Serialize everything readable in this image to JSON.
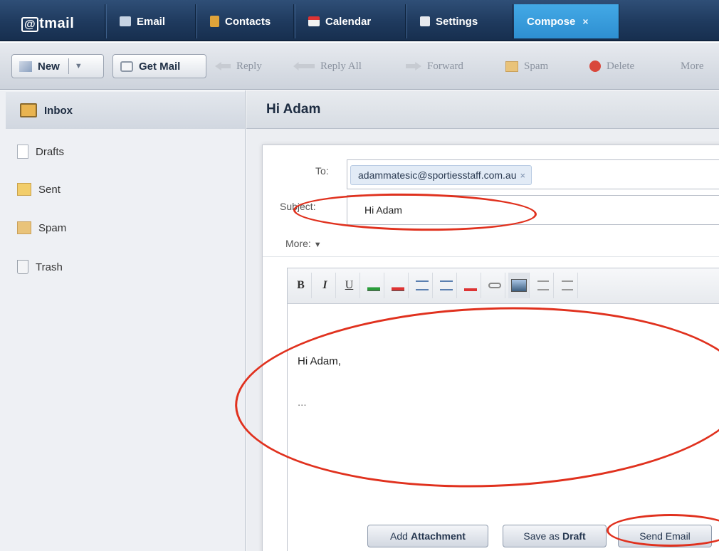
{
  "nav": {
    "logo_at": "@",
    "logo_rest": "tmail",
    "tabs": [
      {
        "label": "Email",
        "icon": "envelope-icon"
      },
      {
        "label": "Contacts",
        "icon": "address-book-icon"
      },
      {
        "label": "Calendar",
        "icon": "calendar-icon"
      },
      {
        "label": "Settings",
        "icon": "settings-icon"
      }
    ],
    "active_tab": {
      "label": "Compose",
      "close": "×"
    }
  },
  "toolbar": {
    "new": "New",
    "new_arrow": "▼",
    "get_mail": "Get Mail",
    "reply": "Reply",
    "reply_all": "Reply All",
    "forward": "Forward",
    "spam": "Spam",
    "delete": "Delete",
    "more": "More"
  },
  "sidebar": {
    "inbox": "Inbox",
    "folders": [
      "Drafts",
      "Sent",
      "Spam",
      "Trash"
    ]
  },
  "message": {
    "title": "Hi Adam"
  },
  "compose": {
    "to_label": "To:",
    "to_recipient": "adammatesic@sportiesstaff.com.au",
    "chip_remove": "×",
    "subject_label": "Subject:",
    "subject_value": "Hi Adam",
    "more_label": "More:",
    "more_arrow": "▼",
    "body_line1": "Hi Adam,",
    "body_line2": "...",
    "add_attachment_pre": "Add",
    "add_attachment_bold": "Attachment",
    "save_draft_pre": "Save as",
    "save_draft_bold": "Draft",
    "send": "Send Email"
  },
  "rte": {
    "bold": "B",
    "italic": "I",
    "underline": "U"
  },
  "colors": {
    "accent": "#2e8fd1",
    "nav_dark": "#1f3a5e",
    "annotation": "#e0311e"
  }
}
